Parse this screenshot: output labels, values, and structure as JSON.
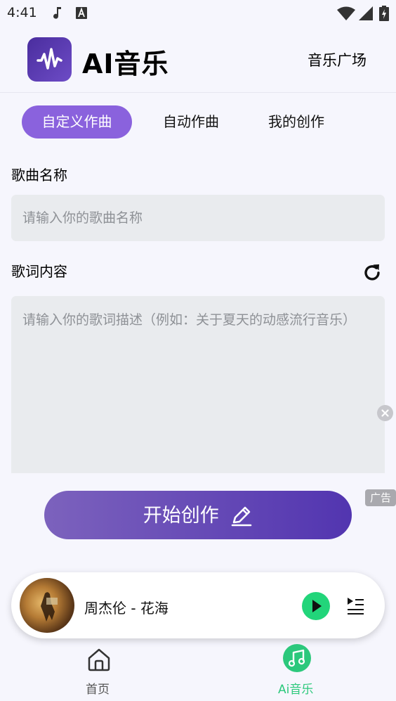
{
  "status_bar": {
    "time": "4:41",
    "icons": [
      "music-note-icon",
      "a-icon",
      "wifi-icon",
      "signal-icon",
      "battery-icon"
    ]
  },
  "header": {
    "logo_icon": "waveform-icon",
    "title": "AI音乐",
    "plaza_link": "音乐广场"
  },
  "tabs": [
    {
      "label": "自定义作曲",
      "active": true
    },
    {
      "label": "自动作曲",
      "active": false
    },
    {
      "label": "我的创作",
      "active": false
    }
  ],
  "form": {
    "song_name_label": "歌曲名称",
    "song_name_placeholder": "请输入你的歌曲名称",
    "song_name_value": "",
    "lyrics_label": "歌词内容",
    "lyrics_placeholder": "请输入你的歌词描述（例如：关于夏天的动感流行音乐）",
    "lyrics_value": ""
  },
  "ad_badge": "广告",
  "start_button": {
    "label": "开始创作",
    "icon": "pencil-icon"
  },
  "player": {
    "song": "周杰伦 - 花海",
    "play_icon": "play-icon",
    "playlist_icon": "playlist-icon"
  },
  "bottom_nav": [
    {
      "label": "首页",
      "icon": "home-icon",
      "active": false
    },
    {
      "label": "Ai音乐",
      "icon": "music-icon",
      "active": true
    }
  ],
  "colors": {
    "accent": "#8a62dd",
    "button_gradient_start": "#7c62bd",
    "button_gradient_end": "#5235b0",
    "active_nav": "#2cc87c",
    "play_button": "#22d57a"
  }
}
